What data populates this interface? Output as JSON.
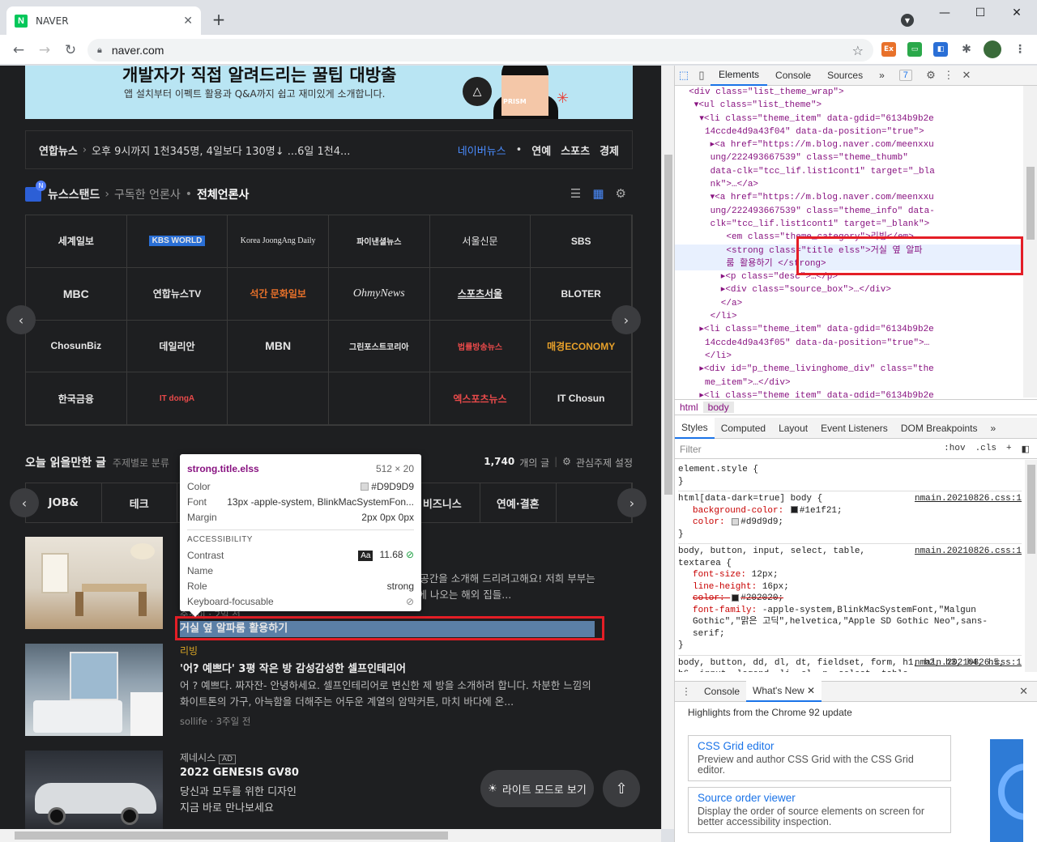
{
  "browser": {
    "tab_title": "NAVER",
    "favicon_letter": "N",
    "url": "naver.com",
    "new_tab": "+",
    "close_tab": "✕"
  },
  "page": {
    "banner": {
      "headline": "개발자가 직접 알려드리는 꿀팁 대방출",
      "subtext": "앱 설치부터 이펙트 활용과 Q&A까지 쉽고 재미있게 소개합니다.",
      "badge": "PRISM"
    },
    "newsbar": {
      "source": "연합뉴스",
      "headline": "오후 9시까지 1천345명, 4일보다 130명↓ ...6일 1천4...",
      "naver_news": "네이버뉴스",
      "dot": "•",
      "links": [
        "연예",
        "스포츠",
        "경제"
      ]
    },
    "newsstand": {
      "title": "뉴스스탠드",
      "subscribed": "구독한 언론사",
      "all": "전체언론사",
      "logo_badge": "N",
      "press": [
        "세계일보",
        "KBS WORLD",
        "Korea JoongAng Daily",
        "파이낸셜뉴스",
        "서울신문",
        "SBS",
        "MBC",
        "연합뉴스TV",
        "석간 문화일보",
        "OhmyNews",
        "스포츠서울",
        "BLOTER",
        "ChosunBiz",
        "데일리안",
        "MBN",
        "그린포스트코리아",
        "법률방송뉴스",
        "매경ECONOMY",
        "한국금융",
        "IT dongA",
        "",
        "",
        "엑스포츠뉴스",
        "IT Chosun"
      ]
    },
    "recommend": {
      "title": "오늘 읽을만한 글",
      "subtitle": "주제별로 분류",
      "count": "1,740",
      "count_suffix": "개의 글",
      "settings": "관심주제 설정",
      "categories": [
        "JOB&",
        "테크",
        "",
        "",
        "건강",
        "비즈니스",
        "연예·결혼",
        ""
      ]
    },
    "articles": [
      {
        "category": "",
        "title": "거실 옆 알파룸 활용하기",
        "desc": "오늘은 저희 부부가 가장 애정을 갖는 저희집의 다이닝룸 공간을 소개해 드리려고해요! 저희 부부는 결혼하기 전부터 다이닝룸에 대한 로망이 있었어요! 영화에 나오는 해외 집들...",
        "meta": "준조이 · 2일 전"
      },
      {
        "category": "리빙",
        "title": "'어? 예쁘다' 3평 작은 방 감성감성한 셀프인테리어",
        "desc": "어 ? 예쁘다. 짜자잔- 안녕하세요. 셀프인테리어로 변신한 제 방을 소개하려 합니다. 차분한 느낌의 화이트톤의 가구, 아늑함을 더해주는 어두운 계열의 암막커튼, 마치 바다에 온...",
        "meta": "sollife · 3주일 전"
      },
      {
        "category": "제네시스",
        "ad": "AD",
        "title": "2022 GENESIS GV80",
        "desc": "당신과 모두를 위한 디자인",
        "desc2": "지금 바로 만나보세요",
        "meta": ""
      }
    ],
    "light_mode": "라이트 모드로 보기",
    "top_button": "⇧"
  },
  "inspector_tooltip": {
    "selector": "strong.title.elss",
    "size": "512 × 20",
    "color_label": "Color",
    "color_value": "#D9D9D9",
    "font_label": "Font",
    "font_value": "13px -apple-system, BlinkMacSystemFon...",
    "margin_label": "Margin",
    "margin_value": "2px 0px 0px",
    "accessibility": "ACCESSIBILITY",
    "contrast_label": "Contrast",
    "contrast_aa": "Aa",
    "contrast_value": "11.68",
    "name_label": "Name",
    "role_label": "Role",
    "role_value": "strong",
    "keyboard_label": "Keyboard-focusable"
  },
  "devtools": {
    "tabs": [
      "Elements",
      "Console",
      "Sources",
      "»"
    ],
    "badge": "7",
    "dom_lines": [
      "  <div class=\"list_theme_wrap\">",
      "   ▾<ul class=\"list_theme\">",
      "    ▾<li class=\"theme_item\" data-gdid=\"6134b9b2e",
      "     14ccde4d9a43f04\" data-da-position=\"true\">",
      "      ▸<a href=\"https://m.blog.naver.com/meenxxu",
      "      ung/222493667539\" class=\"theme_thumb\"",
      "      data-clk=\"tcc_lif.list1cont1\" target=\"_bla",
      "      nk\">…</a>",
      "      ▾<a href=\"https://m.blog.naver.com/meenxxu",
      "      ung/222493667539\" class=\"theme_info\" data-",
      "      clk=\"tcc_lif.list1cont1\" target=\"_blank\">",
      "         <em class=\"theme_category\">리빙</em>",
      "         <strong class=\"title elss\">거실 옆 알파",
      "         룸 활용하기 </strong>",
      "        ▸<p class=\"desc\">…</p>",
      "        ▸<div class=\"source_box\">…</div>",
      "        </a>",
      "      </li>",
      "    ▸<li class=\"theme_item\" data-gdid=\"6134b9b2e",
      "     14ccde4d9a43f05\" data-da-position=\"true\">…",
      "     </li>",
      "    ▸<div id=\"p_theme_livinghome_div\" class=\"the",
      "     me_item\">…</div>",
      "    ▸<li class=\"theme_item\" data-gdid=\"6134b9b2e"
    ],
    "crumbs": [
      "html",
      "body"
    ],
    "style_tabs": [
      "Styles",
      "Computed",
      "Layout",
      "Event Listeners",
      "DOM Breakpoints",
      "»"
    ],
    "filter_placeholder": "Filter",
    "hov": ":hov",
    "cls": ".cls",
    "rules": [
      {
        "selector": "element.style {",
        "src": "",
        "props": [],
        "end": "}"
      },
      {
        "selector": "html[data-dark=true] body {",
        "src": "nmain.20210826.css:1",
        "props": [
          [
            "background-color:",
            "#1e1f21;"
          ],
          [
            "color:",
            "#d9d9d9;"
          ]
        ],
        "end": "}"
      },
      {
        "selector": "body, button, input, select, table, textarea {",
        "src": "nmain.20210826.css:1",
        "props": [
          [
            "font-size:",
            "12px;"
          ],
          [
            "line-height:",
            "16px;"
          ],
          [
            "color:",
            "#202020;"
          ],
          [
            "font-family:",
            "-apple-system,BlinkMacSystemFont,\"Malgun Gothic\",\"맑은 고딕\",helvetica,\"Apple SD Gothic Neo\",sans-serif;"
          ]
        ],
        "end": "}"
      },
      {
        "selector": "body, button, dd, dl, dt, fieldset, form, h1, h2, h3, h4, h5, h6, input, legend, li, ol, p, select, table,",
        "src": "nmain.20210826.css:1",
        "props": [],
        "end": ""
      }
    ],
    "drawer_tabs": [
      "Console",
      "What's New"
    ],
    "whats_new_heading": "Highlights from the Chrome 92 update",
    "cards": [
      {
        "title": "CSS Grid editor",
        "desc": "Preview and author CSS Grid with the CSS Grid editor."
      },
      {
        "title": "Source order viewer",
        "desc": "Display the order of source elements on screen for better accessibility inspection."
      }
    ]
  }
}
